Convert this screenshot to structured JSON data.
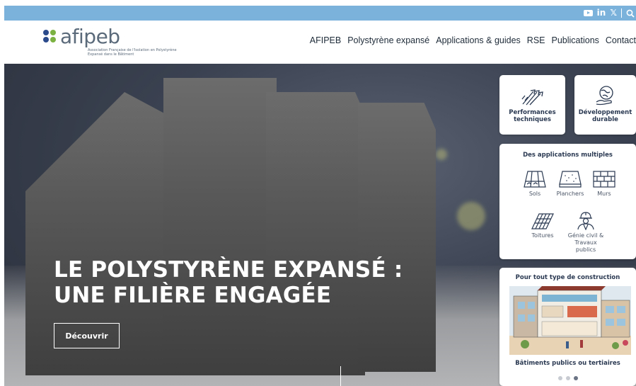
{
  "topbar": {
    "social": {
      "youtube": "youtube-icon",
      "linkedin": "in",
      "x": "𝕏",
      "search": "search-icon"
    }
  },
  "header": {
    "logo": {
      "word": "afipeb",
      "tagline": "Association Française de l'Isolation en Polystyrène Expansé dans le Bâtiment",
      "dot_colors": [
        "#2b4a8c",
        "#7cb241",
        "#2b4a8c",
        "#7cb241"
      ]
    },
    "nav": [
      "AFIPEB",
      "Polystyrène expansé",
      "Applications & guides",
      "RSE",
      "Publications",
      "Contact"
    ]
  },
  "hero": {
    "title_line1": "LE POLYSTYRÈNE EXPANSÉ :",
    "title_line2": "UNE FILIÈRE ENGAGÉE",
    "button": "Découvrir"
  },
  "cards": {
    "performance": {
      "line1": "Performances",
      "line2": "techniques",
      "icon": "arrows-up-icon"
    },
    "durable": {
      "line1": "Développement",
      "line2": "durable",
      "icon": "globe-hand-icon"
    }
  },
  "applications": {
    "title": "Des applications multiples",
    "items": [
      {
        "label": "Sols",
        "icon": "floor-icon"
      },
      {
        "label": "Planchers",
        "icon": "slab-icon"
      },
      {
        "label": "Murs",
        "icon": "wall-icon"
      },
      {
        "label": "Toitures",
        "icon": "roof-icon"
      },
      {
        "label": "Génie civil &",
        "label2": "Travaux publics",
        "icon": "worker-icon"
      }
    ]
  },
  "construction": {
    "title": "Pour tout type de construction",
    "caption": "Bâtiments publics ou tertiaires",
    "carousel_active": 3
  },
  "colors": {
    "topbar": "#7ab2dc",
    "brand_blue": "#2b4a8c",
    "brand_green": "#7cb241",
    "card_text": "#2b3a52"
  }
}
